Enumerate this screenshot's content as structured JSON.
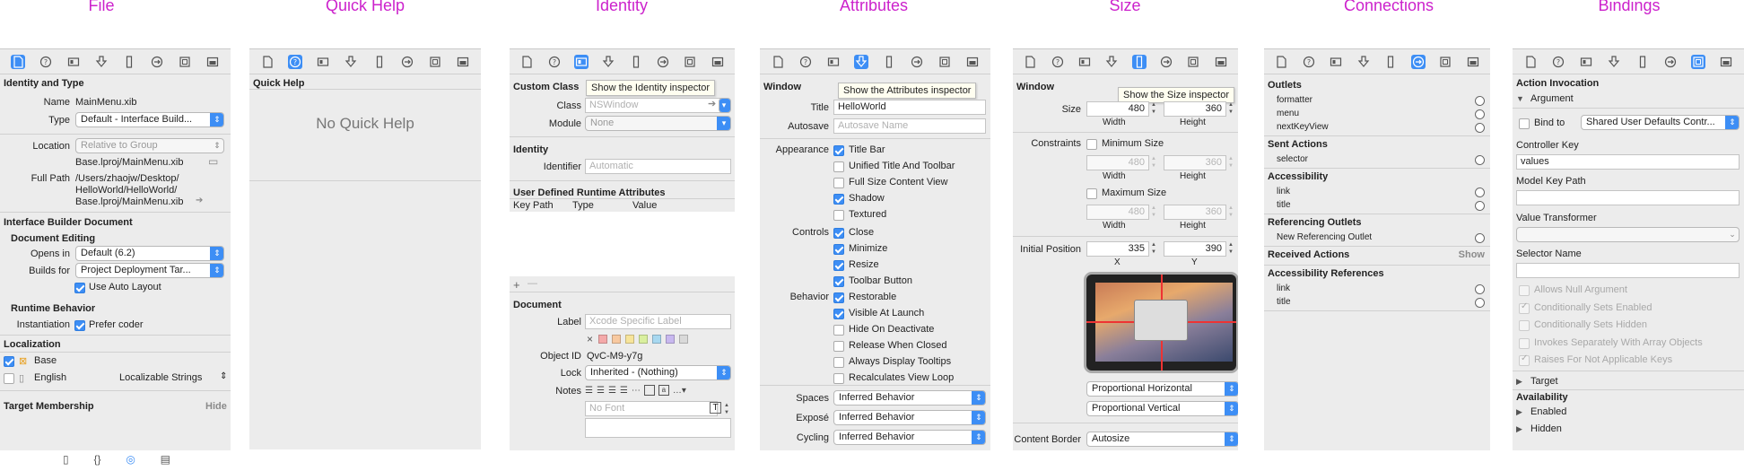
{
  "captions": [
    "File",
    "Quick Help",
    "Identity",
    "Attributes",
    "Size",
    "Connections",
    "Bindings"
  ],
  "accent": "#3d8ef5",
  "caption_color": "#cc22cc",
  "toolbar_icons": [
    "file-icon",
    "quick-help-icon",
    "identity-icon",
    "attributes-icon",
    "size-icon",
    "connections-icon",
    "bindings-icon",
    "effects-icon"
  ],
  "file": {
    "identity_and_type": "Identity and Type",
    "name_label": "Name",
    "name_value": "MainMenu.xib",
    "type_label": "Type",
    "type_value": "Default - Interface Build...",
    "location_label": "Location",
    "location_value": "Relative to Group",
    "location_path": "Base.lproj/MainMenu.xib",
    "fullpath_label": "Full Path",
    "fullpath_1": "/Users/zhaojw/Desktop/",
    "fullpath_2": "HelloWorld/HelloWorld/",
    "fullpath_3": "Base.lproj/MainMenu.xib",
    "ibdoc": "Interface Builder Document",
    "doc_editing": "Document Editing",
    "opens_in_label": "Opens in",
    "opens_in_value": "Default (6.2)",
    "builds_for_label": "Builds for",
    "builds_for_value": "Project Deployment Tar...",
    "use_auto_layout": "Use Auto Layout",
    "runtime_behavior": "Runtime Behavior",
    "instantiation_label": "Instantiation",
    "prefer_coder": "Prefer coder",
    "localization": "Localization",
    "loc_base": "Base",
    "loc_english": "English",
    "loc_english_value": "Localizable Strings",
    "target_membership": "Target Membership",
    "hide": "Hide"
  },
  "quickhelp": {
    "title": "Quick Help",
    "empty": "No Quick Help"
  },
  "identity": {
    "custom_class": "Custom Class",
    "tooltip": "Show the Identity inspector",
    "class_label": "Class",
    "class_placeholder": "NSWindow",
    "module_label": "Module",
    "module_value": "None",
    "identity": "Identity",
    "identifier_label": "Identifier",
    "identifier_placeholder": "Automatic",
    "udra": "User Defined Runtime Attributes",
    "col_keypath": "Key Path",
    "col_type": "Type",
    "col_value": "Value",
    "plus": "+",
    "minus": "—",
    "document": "Document",
    "label_label": "Label",
    "label_placeholder": "Xcode Specific Label",
    "x_mark": "×",
    "objectid_label": "Object ID",
    "objectid_value": "QvC-M9-y7g",
    "lock_label": "Lock",
    "lock_value": "Inherited - (Nothing)",
    "notes_label": "Notes",
    "nofont_placeholder": "No Font",
    "label_colors": [
      "#f4a9a9",
      "#f8c9a0",
      "#f7e49a",
      "#d9ef9e",
      "#a8d8f0",
      "#c8b8ef",
      "#d9d9d9"
    ]
  },
  "attributes": {
    "window": "Window",
    "tooltip": "Show the Attributes inspector",
    "title_label": "Title",
    "title_value": "HelloWorld",
    "autosave_label": "Autosave",
    "autosave_placeholder": "Autosave Name",
    "appearance_label": "Appearance",
    "controls_label": "Controls",
    "behavior_label": "Behavior",
    "checks": [
      {
        "label": "Title Bar",
        "on": true
      },
      {
        "label": "Unified Title And Toolbar",
        "on": false
      },
      {
        "label": "Full Size Content View",
        "on": false
      },
      {
        "label": "Shadow",
        "on": true
      },
      {
        "label": "Textured",
        "on": false
      },
      {
        "label": "Close",
        "on": true
      },
      {
        "label": "Minimize",
        "on": true
      },
      {
        "label": "Resize",
        "on": true
      },
      {
        "label": "Toolbar Button",
        "on": true
      },
      {
        "label": "Restorable",
        "on": true
      },
      {
        "label": "Visible At Launch",
        "on": true
      },
      {
        "label": "Hide On Deactivate",
        "on": false
      },
      {
        "label": "Release When Closed",
        "on": false
      },
      {
        "label": "Always Display Tooltips",
        "on": false
      },
      {
        "label": "Recalculates View Loop",
        "on": false
      }
    ],
    "spaces_label": "Spaces",
    "spaces_value": "Inferred Behavior",
    "expose_label": "Exposé",
    "expose_value": "Inferred Behavior",
    "cycling_label": "Cycling",
    "cycling_value": "Inferred Behavior"
  },
  "size": {
    "window": "Window",
    "tooltip": "Show the Size inspector",
    "size_label": "Size",
    "width_value": "480",
    "height_value": "360",
    "width_label": "Width",
    "height_label": "Height",
    "constraints_label": "Constraints",
    "min_size": "Minimum Size",
    "min_w": "480",
    "min_h": "360",
    "max_size": "Maximum Size",
    "max_w": "480",
    "max_h": "360",
    "initial_pos_label": "Initial Position",
    "x_value": "335",
    "y_value": "390",
    "x_label": "X",
    "y_label": "Y",
    "prop_h": "Proportional Horizontal",
    "prop_v": "Proportional Vertical",
    "content_border_label": "Content Border",
    "content_border_value": "Autosize"
  },
  "connections": {
    "outlets": "Outlets",
    "outlet_items": [
      "formatter",
      "menu",
      "nextKeyView"
    ],
    "sent_actions": "Sent Actions",
    "sent_items": [
      "selector"
    ],
    "accessibility": "Accessibility",
    "acc_items": [
      "link",
      "title"
    ],
    "referencing_outlets": "Referencing Outlets",
    "ref_items": [
      "New Referencing Outlet"
    ],
    "received_actions": "Received Actions",
    "show": "Show",
    "acc_refs": "Accessibility References",
    "acc_ref_items": [
      "link",
      "title"
    ]
  },
  "bindings": {
    "action_invocation": "Action Invocation",
    "argument": "Argument",
    "bind_to": "Bind to",
    "bind_to_value": "Shared User Defaults Contr...",
    "controller_key": "Controller Key",
    "controller_key_value": "values",
    "model_key_path": "Model Key Path",
    "value_transformer": "Value Transformer",
    "selector_name": "Selector Name",
    "options": [
      {
        "label": "Allows Null Argument",
        "checked": false
      },
      {
        "label": "Conditionally Sets Enabled",
        "checked": true
      },
      {
        "label": "Conditionally Sets Hidden",
        "checked": false
      },
      {
        "label": "Invokes Separately With Array Objects",
        "checked": false
      },
      {
        "label": "Raises For Not Applicable Keys",
        "checked": true
      }
    ],
    "target": "Target",
    "availability": "Availability",
    "enabled": "Enabled",
    "hidden": "Hidden"
  }
}
